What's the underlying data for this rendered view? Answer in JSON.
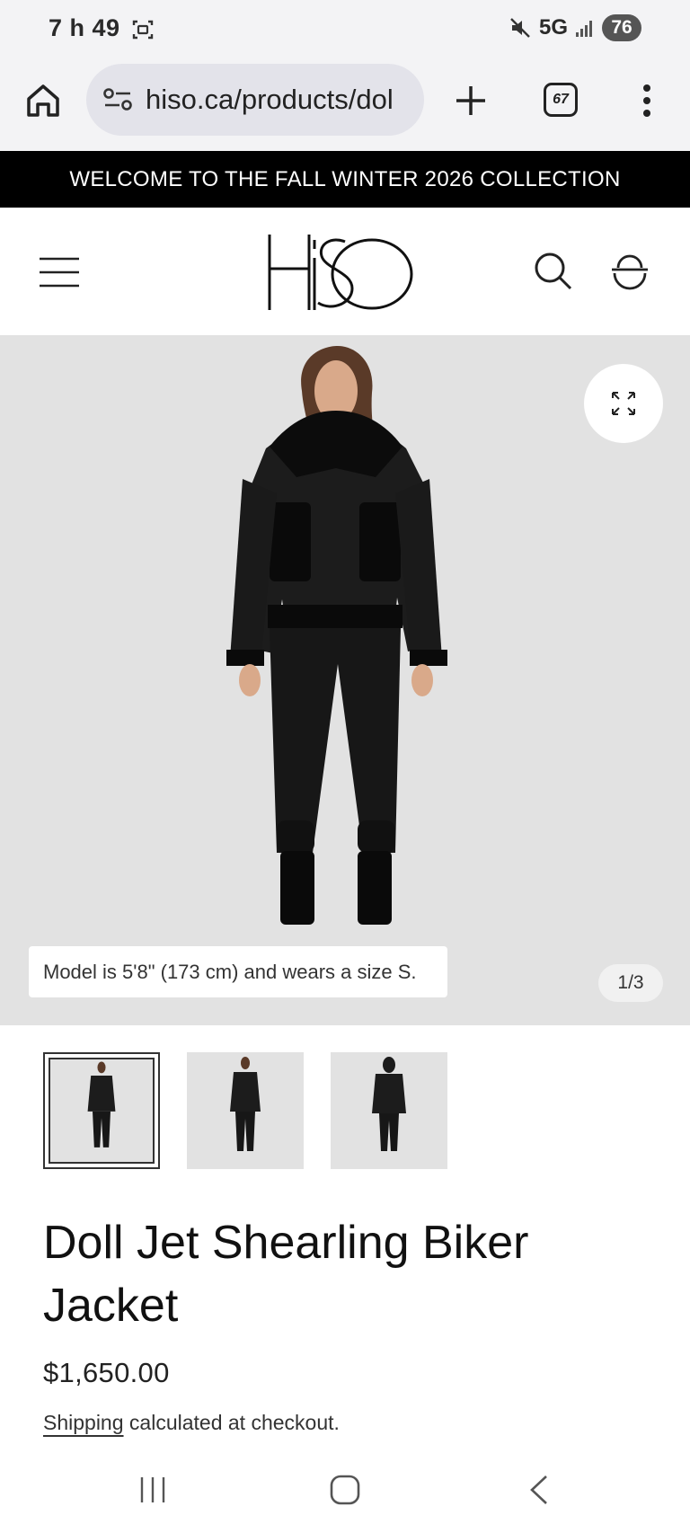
{
  "status_bar": {
    "time": "7 h 49",
    "network": "5G",
    "battery": "76",
    "icons": [
      "screenshot-icon",
      "mute-icon",
      "signal-icon"
    ]
  },
  "browser": {
    "url": "hiso.ca/products/dol",
    "tab_count": "67",
    "icons": [
      "home-icon",
      "site-info-icon",
      "plus-icon",
      "tabs-icon",
      "more-vert-icon"
    ]
  },
  "announcement": "WELCOME TO THE FALL WINTER 2026 COLLECTION",
  "header": {
    "logo_text": "HISO",
    "icons": [
      "hamburger-menu-icon",
      "search-icon",
      "cart-icon"
    ]
  },
  "gallery": {
    "caption": "Model is 5'8\" (173 cm) and wears a size S.",
    "counter": "1/3",
    "thumbnails": [
      {
        "view": "front",
        "active": true
      },
      {
        "view": "front-open",
        "active": false
      },
      {
        "view": "back",
        "active": false
      }
    ]
  },
  "product": {
    "title": "Doll Jet Shearling Biker Jacket",
    "price": "$1,650.00",
    "shipping_link": "Shipping",
    "shipping_rest": " calculated at checkout."
  },
  "colors": {
    "announcement_bg": "#000000",
    "gallery_bg": "#e2e2e2",
    "chrome_bg": "#f3f3f5"
  }
}
